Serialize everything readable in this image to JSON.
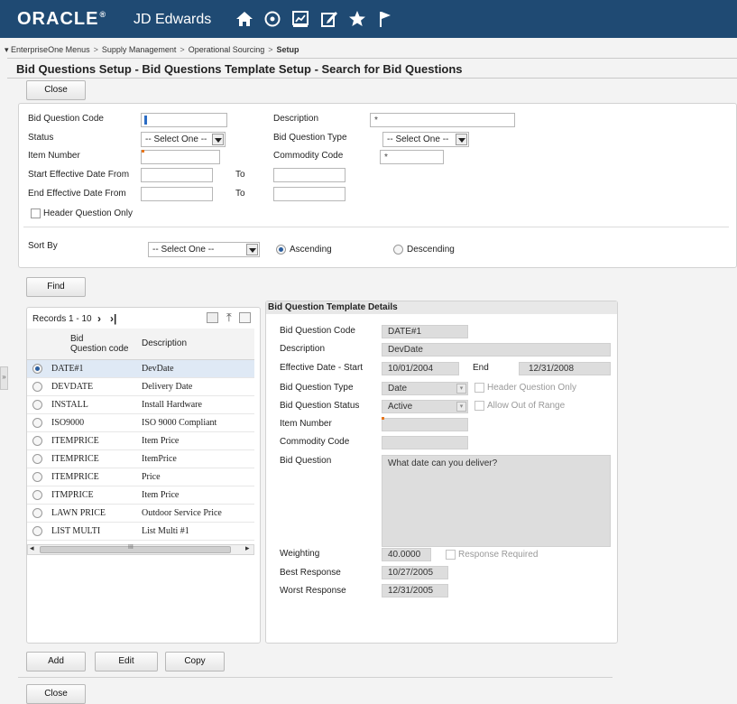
{
  "brand": {
    "name": "ORACLE",
    "product": "JD Edwards"
  },
  "topbar": {
    "icons": [
      "home-icon",
      "recent-icon",
      "chart-icon",
      "edit-icon",
      "star-icon",
      "flag-icon"
    ]
  },
  "breadcrumb": [
    "EnterpriseOne Menus",
    "Supply Management",
    "Operational Sourcing",
    "Setup"
  ],
  "page_title": "Bid Questions Setup - Bid Questions Template Setup - Search for Bid Questions",
  "buttons": {
    "close": "Close",
    "find": "Find",
    "add": "Add",
    "edit": "Edit",
    "copy": "Copy"
  },
  "search": {
    "bid_question_code": {
      "label": "Bid Question Code",
      "value": ""
    },
    "description": {
      "label": "Description",
      "value": "*"
    },
    "status": {
      "label": "Status",
      "value": "-- Select One --"
    },
    "bid_question_type": {
      "label": "Bid Question Type",
      "value": "-- Select One --"
    },
    "item_number": {
      "label": "Item Number",
      "value": ""
    },
    "commodity_code": {
      "label": "Commodity Code",
      "value": "*"
    },
    "start_effective": {
      "label": "Start Effective Date From",
      "to": "To"
    },
    "end_effective": {
      "label": "End Effective Date From",
      "to": "To"
    },
    "header_only": {
      "label": "Header Question Only",
      "checked": false
    },
    "sort_by": {
      "label": "Sort By",
      "value": "-- Select One --"
    },
    "ascending": "Ascending",
    "descending": "Descending"
  },
  "grid": {
    "records": "Records 1 - 10",
    "columns": [
      "Bid Question code",
      "Description"
    ],
    "col1_line1": "Bid",
    "col1_line2": "Question code",
    "rows": [
      {
        "code": "DATE#1",
        "desc": "DevDate",
        "selected": true
      },
      {
        "code": "DEVDATE",
        "desc": "Delivery Date",
        "selected": false
      },
      {
        "code": "INSTALL",
        "desc": "Install Hardware",
        "selected": false
      },
      {
        "code": "ISO9000",
        "desc": "ISO 9000 Compliant",
        "selected": false
      },
      {
        "code": "ITEMPRICE",
        "desc": "Item Price",
        "selected": false
      },
      {
        "code": "ITEMPRICE",
        "desc": "ItemPrice",
        "selected": false
      },
      {
        "code": "ITEMPRICE",
        "desc": "Price",
        "selected": false
      },
      {
        "code": "ITMPRICE",
        "desc": "Item Price",
        "selected": false
      },
      {
        "code": "LAWN PRICE",
        "desc": "Outdoor Service Price",
        "selected": false
      },
      {
        "code": "LIST MULTI",
        "desc": "List Multi #1",
        "selected": false
      }
    ],
    "scroll_mark": "III"
  },
  "details": {
    "title": "Bid Question Template Details",
    "bid_question_code": {
      "label": "Bid Question Code",
      "value": "DATE#1"
    },
    "description": {
      "label": "Description",
      "value": "DevDate"
    },
    "effective_start": {
      "label": "Effective Date - Start",
      "value": "10/01/2004"
    },
    "end": {
      "label": "End",
      "value": "12/31/2008"
    },
    "type": {
      "label": "Bid Question Type",
      "value": "Date"
    },
    "header_only": "Header Question Only",
    "status": {
      "label": "Bid Question Status",
      "value": "Active"
    },
    "allow_out_of_range": "Allow Out of Range",
    "item_number": {
      "label": "Item Number",
      "value": ""
    },
    "commodity_code": {
      "label": "Commodity Code",
      "value": ""
    },
    "bid_question": {
      "label": "Bid Question",
      "value": "What date can you deliver?"
    },
    "weighting": {
      "label": "Weighting",
      "value": "40.0000"
    },
    "response_required": "Response Required",
    "best_response": {
      "label": "Best Response",
      "value": "10/27/2005"
    },
    "worst_response": {
      "label": "Worst Response",
      "value": "12/31/2005"
    }
  }
}
